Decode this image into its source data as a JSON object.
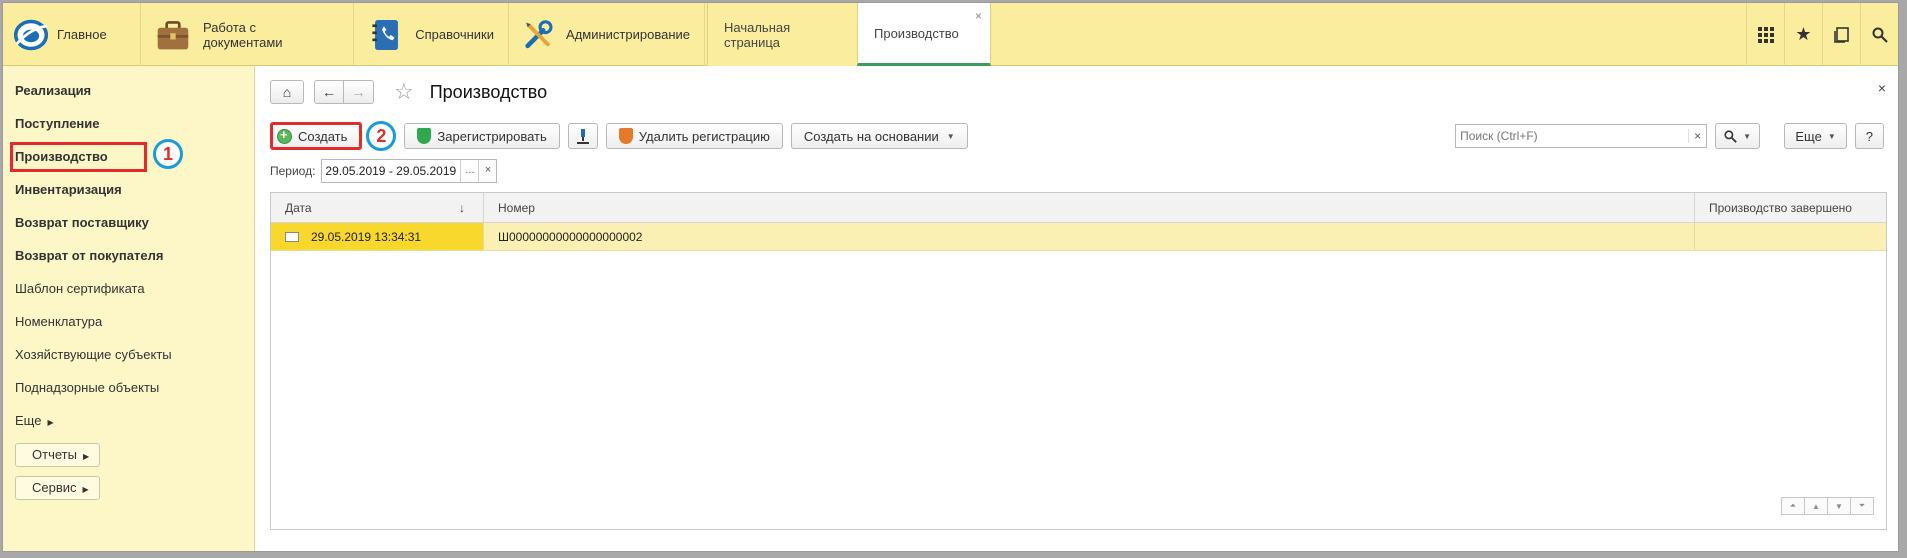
{
  "topbar": {
    "sections": [
      {
        "label": "Главное",
        "icon": "1c-logo-icon"
      },
      {
        "label": "Работа с документами",
        "icon": "briefcase-icon"
      },
      {
        "label": "Справочники",
        "icon": "phonebook-icon"
      },
      {
        "label": "Администрирование",
        "icon": "tools-icon"
      }
    ],
    "tabs": [
      {
        "label": "Начальная страница"
      },
      {
        "label": "Производство",
        "close": "×"
      }
    ],
    "tools": {
      "apps": "grid-icon",
      "favorites": "star-icon",
      "history": "history-icon",
      "search": "search-icon"
    }
  },
  "sidebar": {
    "items": [
      {
        "label": "Реализация",
        "bold": true
      },
      {
        "label": "Поступление",
        "bold": true
      },
      {
        "label": "Производство",
        "bold": true
      },
      {
        "label": "Инвентаризация",
        "bold": true
      },
      {
        "label": "Возврат поставщику",
        "bold": true
      },
      {
        "label": "Возврат от покупателя",
        "bold": true
      },
      {
        "label": "Шаблон сертификата",
        "bold": false
      },
      {
        "label": "Номенклатура",
        "bold": false
      },
      {
        "label": "Хозяйствующие субъекты",
        "bold": false
      },
      {
        "label": "Поднадзорные объекты",
        "bold": false
      }
    ],
    "more": "Еще",
    "reports": "Отчеты",
    "service": "Сервис"
  },
  "annotations": {
    "badge1": "1",
    "badge2": "2"
  },
  "form": {
    "title": "Производство",
    "close": "×",
    "toolbar": {
      "create": "Создать",
      "register": "Зарегистрировать",
      "unregister": "Удалить регистрацию",
      "create_based": "Создать на основании"
    },
    "search_placeholder": "Поиск (Ctrl+F)",
    "more": "Еще",
    "help": "?",
    "period_label": "Период:",
    "period_value": "29.05.2019 - 29.05.2019",
    "period_select": "...",
    "period_clear": "×"
  },
  "grid": {
    "columns": [
      "Дата",
      "Номер",
      "Производство завершено"
    ],
    "rows": [
      {
        "date": "29.05.2019 13:34:31",
        "number": "Ш00000000000000000002",
        "done": ""
      }
    ]
  },
  "colors": {
    "accent_yellow": "#fbed9e",
    "selected_row": "#fbf0b3",
    "selected_cell": "#f8d82c",
    "annotation_red": "#e32b2b",
    "annotation_blue": "#1a9ad8"
  }
}
